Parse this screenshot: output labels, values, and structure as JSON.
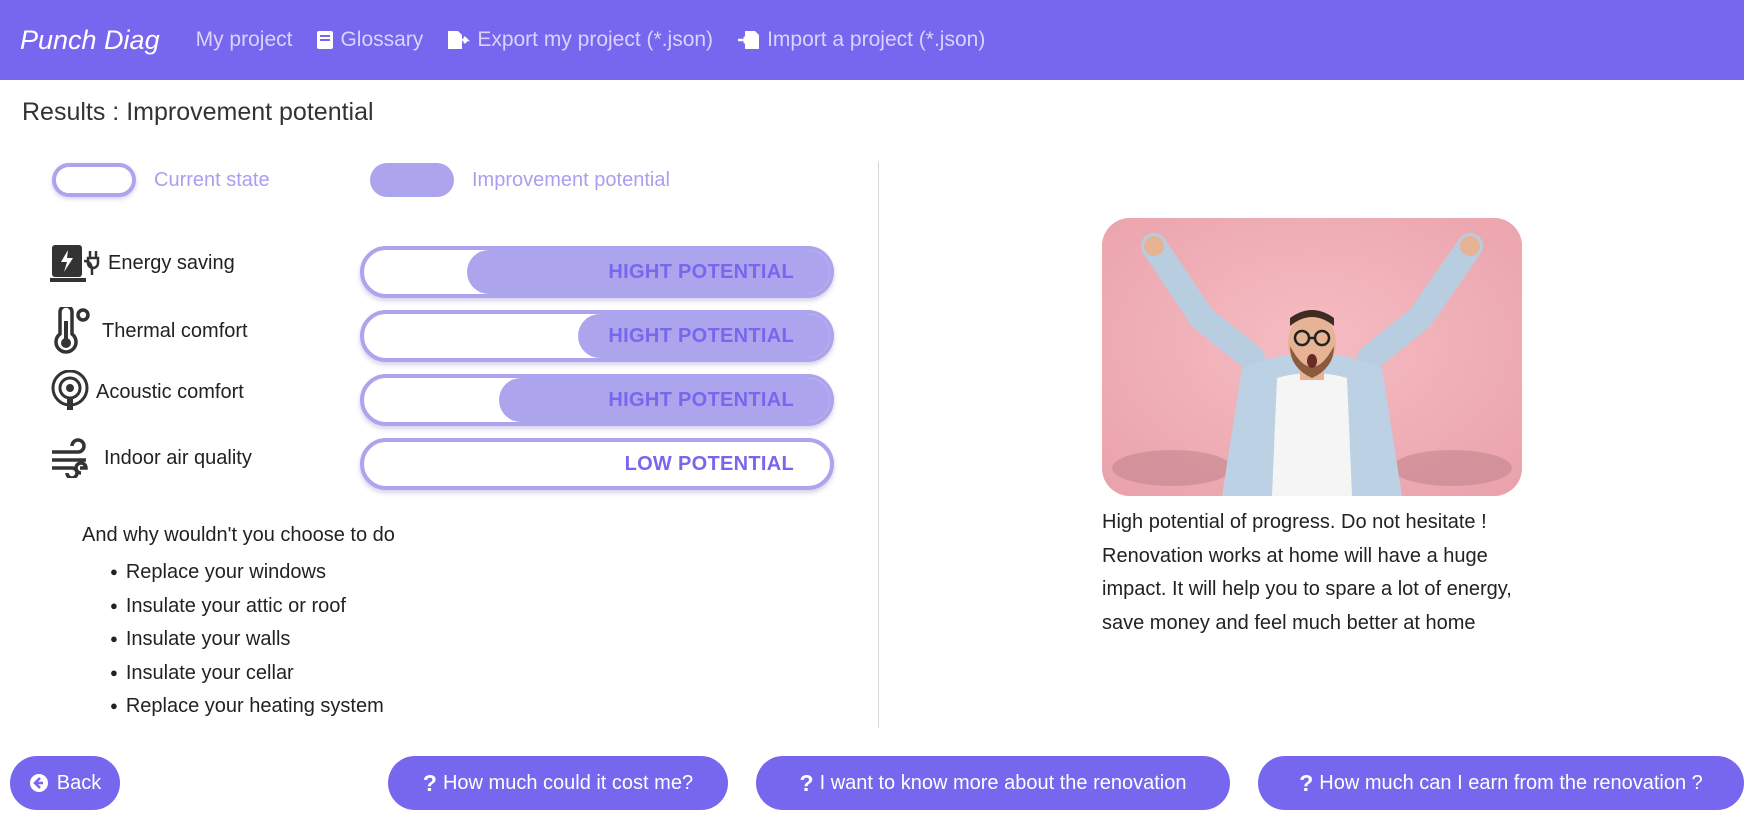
{
  "nav": {
    "brand": "Punch Diag",
    "links": [
      "My project",
      "Glossary",
      "Export my project (*.json)",
      "Import a project (*.json)"
    ]
  },
  "page_title": "Results : Improvement potential",
  "legend": {
    "current": "Current state",
    "improvement": "Improvement potential"
  },
  "criteria": [
    {
      "label": "Energy saving",
      "potential": "HIGHT POTENTIAL",
      "icon": "energy-charger-icon",
      "improvement_fraction": 0.78
    },
    {
      "label": "Thermal comfort",
      "potential": "HIGHT POTENTIAL",
      "icon": "thermometer-icon",
      "improvement_fraction": 0.54
    },
    {
      "label": "Acoustic comfort",
      "potential": "HIGHT POTENTIAL",
      "icon": "ear-icon",
      "improvement_fraction": 0.71
    },
    {
      "label": "Indoor air quality",
      "potential": "LOW POTENTIAL",
      "icon": "wind-icon",
      "improvement_fraction": 0.0
    }
  ],
  "suggestions": {
    "title": "And why wouldn't you choose to do",
    "items": [
      "Replace your windows",
      "Insulate your attic or roof",
      "Insulate your walls",
      "Insulate your cellar",
      "Replace your heating system"
    ]
  },
  "result_text": "High potential of progress. Do not hesitate ! Renovation works at home will have a huge impact. It will help you to spare a lot of energy, save money and feel much better at home",
  "buttons": {
    "back": "Back",
    "cost": "How much could it cost me?",
    "more": "I want to know more about the renovation",
    "earn": "How much can I earn from the renovation ?"
  },
  "colors": {
    "accent": "#7766ee",
    "bar_fill": "#aca5ee",
    "photo_bg": "#efa9b1"
  }
}
